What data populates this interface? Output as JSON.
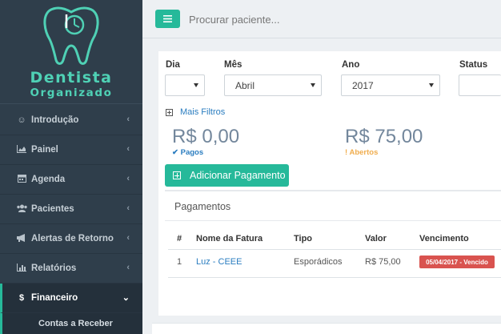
{
  "brand": {
    "line1": "Dentista",
    "line2": "Organizado",
    "accent_color": "#4fd1b5",
    "icon": "tooth-logo-icon"
  },
  "topbar": {
    "search_placeholder": "Procurar paciente..."
  },
  "sidebar": {
    "items": [
      {
        "label": "Introdução",
        "icon": "smile-icon"
      },
      {
        "label": "Painel",
        "icon": "area-chart-icon"
      },
      {
        "label": "Agenda",
        "icon": "calendar-icon"
      },
      {
        "label": "Pacientes",
        "icon": "users-icon"
      },
      {
        "label": "Alertas de Retorno",
        "icon": "bullhorn-icon"
      },
      {
        "label": "Relatórios",
        "icon": "bar-chart-icon"
      },
      {
        "label": "Financeiro",
        "icon": "dollar-icon"
      }
    ],
    "submenu": {
      "label": "Contas a Receber"
    }
  },
  "filters": {
    "dia": {
      "label": "Dia",
      "value": ""
    },
    "mes": {
      "label": "Mês",
      "value": "Abril"
    },
    "ano": {
      "label": "Ano",
      "value": "2017"
    },
    "status": {
      "label": "Status",
      "value": ""
    },
    "more": "Mais Filtros"
  },
  "summary": {
    "paid": {
      "amount": "R$ 0,00",
      "label": "Pagos",
      "color": "#2a7dc0"
    },
    "open": {
      "amount": "R$ 75,00",
      "label": "Abertos",
      "color": "#f0ad4e"
    }
  },
  "add_button": "Adicionar Pagamento",
  "payments": {
    "title": "Pagamentos",
    "columns": [
      "#",
      "Nome da Fatura",
      "Tipo",
      "Valor",
      "Vencimento"
    ],
    "rows": [
      {
        "num": "1",
        "name": "Luz - CEEE",
        "type": "Esporádicos",
        "value": "R$ 75,00",
        "due": "05/04/2017 - Vencido",
        "due_color": "#d9534f"
      }
    ]
  }
}
